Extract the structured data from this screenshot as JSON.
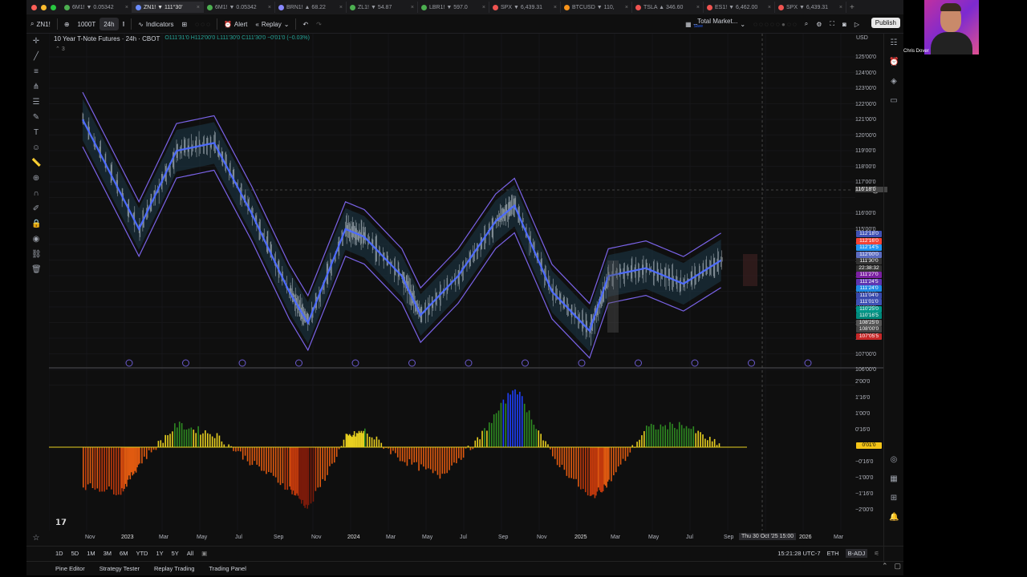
{
  "tabs": [
    {
      "label": "6M1! ▼ 0.05342",
      "color": "#4caf50"
    },
    {
      "label": "ZN1! ▼ 111°30'",
      "color": "#6a8cff",
      "active": true
    },
    {
      "label": "6M1! ▼ 0.05342",
      "color": "#4caf50"
    },
    {
      "label": "BRN1! ▲ 68.22",
      "color": "#8888ff"
    },
    {
      "label": "ZL1! ▼ 54.87",
      "color": "#4caf50"
    },
    {
      "label": "LBR1! ▼ 597.0",
      "color": "#4caf50"
    },
    {
      "label": "SPX ▼ 6,439.31",
      "color": "#ef5350"
    },
    {
      "label": "BTCUSD ▼ 110,",
      "color": "#f7931a"
    },
    {
      "label": "TSLA ▲ 346.60",
      "color": "#ef5350"
    },
    {
      "label": "ES1! ▼ 6,462.00",
      "color": "#ef5350"
    },
    {
      "label": "SPX ▼ 6,439.31",
      "color": "#ef5350"
    }
  ],
  "toolbar": {
    "symbol": "ZN1!",
    "interval_tick": "1000T",
    "interval_24h": "24h",
    "indicators": "Indicators",
    "alert": "Alert",
    "replay": "Replay",
    "layout": "_Total Market...",
    "layout_sub": "Save",
    "publish": "Publish"
  },
  "legend": {
    "title": "10 Year T-Note Futures · 24h · CBOT",
    "ohlc": "O111'31'0 H112'00'0 L111'30'0 C111'30'0 −0'01'0 (−0.03%)",
    "count": "3"
  },
  "currency": "USD",
  "price_axis": [
    "125'00'0",
    "124'00'0",
    "123'00'0",
    "122'00'0",
    "121'00'0",
    "120'00'0",
    "119'00'0",
    "118'00'0",
    "117'00'0",
    "116'18'0",
    "116'00'0",
    "115'00'0",
    "114'00'0",
    "113'00'0",
    "112'00'0",
    "111'00'0",
    "110'00'0",
    "109'00'0",
    "108'00'0",
    "107'00'0",
    "106'00'0"
  ],
  "price_tags": [
    {
      "label": "112'18'0",
      "color": "#3f51b5"
    },
    {
      "label": "112'16'0",
      "color": "#f44336"
    },
    {
      "label": "112'14'5",
      "color": "#2196f3"
    },
    {
      "label": "112'00'0",
      "color": "#5c6bc0"
    },
    {
      "label": "111'30'0",
      "color": "#333333"
    },
    {
      "label": "22:38:32",
      "color": "#333333"
    },
    {
      "label": "111'27'0",
      "color": "#7b1fa2"
    },
    {
      "label": "111'24'5",
      "color": "#5e35b1"
    },
    {
      "label": "111'24'0",
      "color": "#1e88e5"
    },
    {
      "label": "111'04'0",
      "color": "#3949ab"
    },
    {
      "label": "111'01'0",
      "color": "#3f51b5"
    },
    {
      "label": "110'25'0",
      "color": "#009688"
    },
    {
      "label": "110'16'5",
      "color": "#00897b"
    },
    {
      "label": "108'25'0",
      "color": "#555555"
    },
    {
      "label": "108'00'0",
      "color": "#444444"
    },
    {
      "label": "107'05'5",
      "color": "#c62828"
    }
  ],
  "osc_axis": [
    "2'00'0",
    "1'16'0",
    "1'00'0",
    "0'16'0",
    "−0'16'0",
    "−1'00'0",
    "−1'16'0",
    "−2'00'0"
  ],
  "osc_tag": "0'01'0",
  "x_axis": [
    "Nov",
    "2023",
    "Mar",
    "May",
    "Jul",
    "Sep",
    "Nov",
    "2024",
    "Mar",
    "May",
    "Jul",
    "Sep",
    "Nov",
    "2025",
    "Mar",
    "May",
    "Jul",
    "Sep",
    "2026",
    "Mar"
  ],
  "crosshair_time": "Thu 30 Oct '25   15:00",
  "ranges": [
    "1D",
    "5D",
    "1M",
    "3M",
    "6M",
    "YTD",
    "1Y",
    "5Y",
    "All"
  ],
  "bottom_right": {
    "time": "15:21:28 UTC-7",
    "session": "ETH",
    "adj": "B-ADJ"
  },
  "statusbar": [
    "Pine Editor",
    "Strategy Tester",
    "Replay Trading",
    "Trading Panel"
  ],
  "webcam_name": "Chris Dover",
  "chart_data": {
    "type": "line",
    "price": {
      "x": [
        "2022-10",
        "2023-01",
        "2023-03",
        "2023-05",
        "2023-07",
        "2023-09",
        "2023-10",
        "2023-12",
        "2024-01",
        "2024-03",
        "2024-04",
        "2024-06",
        "2024-08",
        "2024-09",
        "2024-11",
        "2025-01",
        "2025-02",
        "2025-04",
        "2025-06",
        "2025-08"
      ],
      "y": [
        121,
        114,
        119,
        119.5,
        115,
        110,
        108,
        114,
        113.5,
        111,
        108.5,
        111,
        114.5,
        115.5,
        110,
        107.5,
        111,
        111.5,
        110.5,
        112
      ]
    },
    "oscillator": {
      "x": [
        "2022-10",
        "2022-12",
        "2023-01",
        "2023-03",
        "2023-05",
        "2023-07",
        "2023-09",
        "2023-10",
        "2023-12",
        "2024-01",
        "2024-03",
        "2024-05",
        "2024-07",
        "2024-09",
        "2024-11",
        "2025-01",
        "2025-02",
        "2025-04",
        "2025-06",
        "2025-08"
      ],
      "y": [
        -1.2,
        -1.4,
        -0.5,
        0.7,
        0.4,
        -0.5,
        -1.3,
        -1.9,
        0.3,
        0.5,
        -0.4,
        -0.9,
        0.2,
        1.9,
        -0.3,
        -1.6,
        -1.1,
        0.6,
        0.7,
        0.0
      ]
    }
  }
}
